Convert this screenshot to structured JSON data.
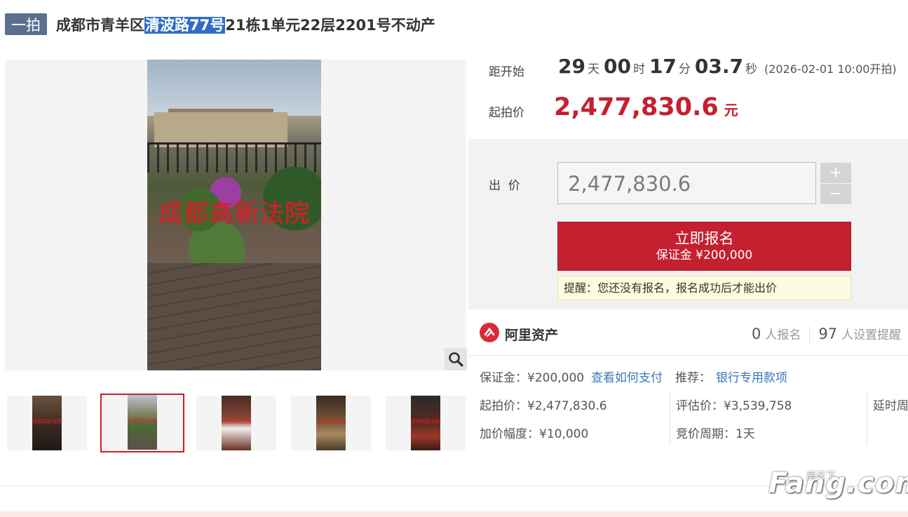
{
  "header": {
    "badge": "一拍",
    "title_pre": "成都市青羊区",
    "title_highlight": "清波路77号",
    "title_post": "21栋1单元22层2201号不动产"
  },
  "gallery": {
    "main_watermark": "成都高新法院",
    "zoom_icon": "zoom-in-icon",
    "thumbnails": [
      {
        "watermark": "成都高新法院"
      },
      {
        "watermark": "成都高新法院"
      },
      {
        "watermark": "成都高新法院"
      },
      {
        "watermark": "成都高新法院"
      },
      {
        "watermark": "成都高新法院"
      }
    ],
    "selected_index": 1
  },
  "countdown": {
    "label": "距开始",
    "days": "29",
    "days_unit": "天",
    "hours": "00",
    "hours_unit": "时",
    "minutes": "17",
    "minutes_unit": "分",
    "seconds": "03.7",
    "seconds_unit": "秒",
    "start_note": "(2026-02-01 10:00开拍)"
  },
  "start_price": {
    "label": "起拍价",
    "value": "2,477,830.6",
    "unit": "元"
  },
  "bid": {
    "label": "出  价",
    "input_value": "2,477,830.6",
    "plus": "+",
    "minus": "−",
    "signup_title": "立即报名",
    "signup_deposit": "保证金 ¥200,000",
    "tip": "提醒：您还没有报名，报名成功后才能出价"
  },
  "org": {
    "name": "阿里资产",
    "signup_count": "0",
    "signup_label": "人报名",
    "remind_count": "97",
    "remind_label": "人设置提醒"
  },
  "details": {
    "deposit_label": "保证金：",
    "deposit_value": "¥200,000",
    "how_to_pay": "查看如何支付",
    "recommend_label": "推荐：",
    "recommend_value": "银行专用款项",
    "start_price_label": "起拍价：",
    "start_price_value": "¥2,477,830.6",
    "eval_label": "评估价：",
    "eval_value": "¥3,539,758",
    "delay_label": "延时周",
    "increment_label": "加价幅度：",
    "increment_value": "¥10,000",
    "period_label": "竞价周期：",
    "period_value": "1天"
  },
  "watermark": {
    "brand": "Fang.com",
    "brand_cn": "房天下"
  },
  "colors": {
    "accent": "#c4202f",
    "link": "#3a76b8",
    "badge": "#5b6f8e"
  }
}
